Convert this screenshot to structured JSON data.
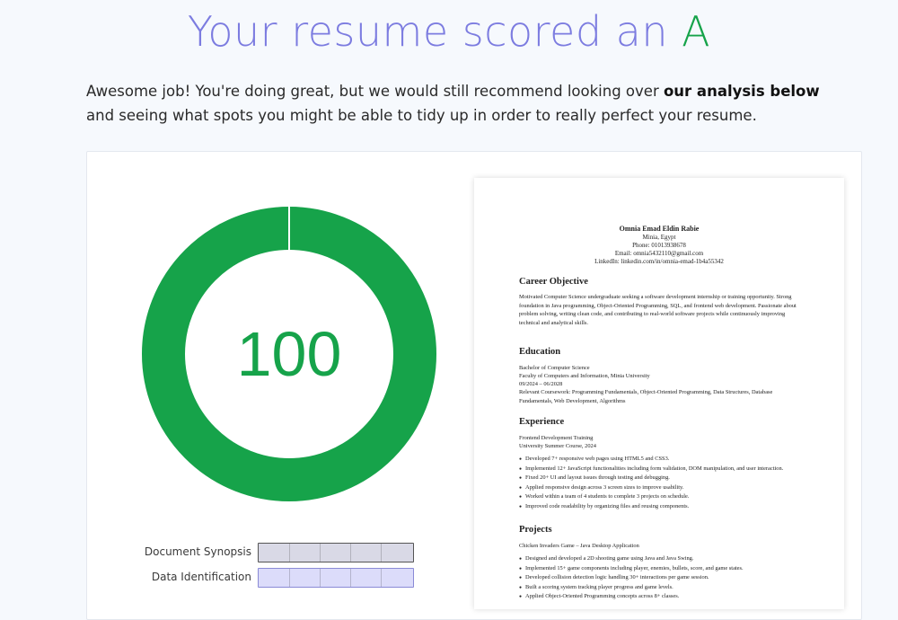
{
  "header": {
    "title_prefix": "Your resume scored an",
    "grade": "A"
  },
  "intro": {
    "before": "Awesome job! You're doing great, but we would still recommend looking over ",
    "bold": "our analysis below",
    "after": " and seeing what spots you might be able to tidy up in order to really perfect your resume."
  },
  "score": {
    "value": 100,
    "max": 100,
    "display": "100",
    "color": "#16a34a"
  },
  "breakdown": [
    {
      "label": "Document Synopsis",
      "fill": "#d9d9e6"
    },
    {
      "label": "Data Identification",
      "fill": "#dcdcfa"
    }
  ],
  "resume": {
    "name": "Omnia Emad Eldin Rabie",
    "location": "Minia, Egypt",
    "phone": "Phone: 01013938678",
    "email": "Email: omnia5432110@gmail.com",
    "linkedin": "LinkedIn: linkedin.com/in/omnia-emad-1b4a55342",
    "career_heading": "Career Objective",
    "career_text": "Motivated Computer Science undergraduate seeking a software development internship or training opportunity. Strong foundation in Java programming, Object-Oriented Programming, SQL, and frontend web development. Passionate about problem solving, writing clean code, and contributing to real-world software projects while continuously improving technical and analytical skills.",
    "education_heading": "Education",
    "education_lines": [
      "Bachelor of Computer Science",
      "Faculty of Computers and Information, Minia University",
      "09/2024 – 06/2028",
      "Relevant Coursework: Programming Fundamentals, Object-Oriented Programming, Data Structures, Database Fundamentals, Web Development, Algorithms"
    ],
    "experience_heading": "Experience",
    "experience_title": "Frontend Development Training",
    "experience_sub": "University Summer Course, 2024",
    "experience_bullets": [
      "Developed 7+ responsive web pages using HTML5 and CSS3.",
      "Implemented 12+ JavaScript functionalities including form validation, DOM manipulation, and user interaction.",
      "Fixed 20+ UI and layout issues through testing and debugging.",
      "Applied responsive design across 3 screen sizes to improve usability.",
      "Worked within a team of 4 students to complete 3 projects on schedule.",
      "Improved code readability by organizing files and reusing components."
    ],
    "projects_heading": "Projects",
    "project_title": "Chicken Invaders Game – Java Desktop Application",
    "project_bullets": [
      "Designed and developed a 2D shooting game using Java and Java Swing.",
      "Implemented 15+ game components including player, enemies, bullets, score, and game states.",
      "Developed collision detection logic handling 30+ interactions per game session.",
      "Built a scoring system tracking player progress and game levels.",
      "Applied Object-Oriented Programming concepts across 8+ classes."
    ]
  }
}
